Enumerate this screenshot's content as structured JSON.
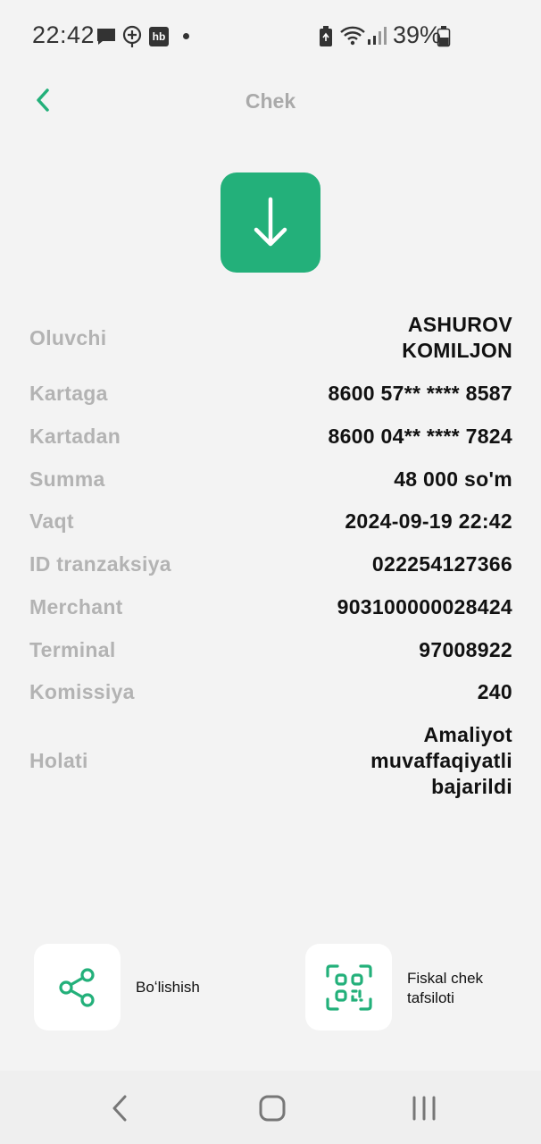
{
  "status_bar": {
    "time": "22:42",
    "battery_percent": "39%",
    "icons": [
      "message-icon",
      "add-location-icon",
      "hb-app-icon",
      "dot-icon",
      "battery-saver-icon",
      "wifi-icon",
      "signal-icon",
      "battery-icon"
    ],
    "hb_label": "hb"
  },
  "header": {
    "title": "Chek",
    "back_icon": "chevron-left-icon"
  },
  "download": {
    "icon": "arrow-down-icon",
    "color": "#23b07a"
  },
  "details": [
    {
      "label": "Oluvchi",
      "value": "ASHUROV\nKOMILJON"
    },
    {
      "label": "Kartaga",
      "value": "8600 57** **** 8587"
    },
    {
      "label": "Kartadan",
      "value": "8600 04** **** 7824"
    },
    {
      "label": "Summa",
      "value": "48 000 so'm"
    },
    {
      "label": "Vaqt",
      "value": "2024-09-19 22:42"
    },
    {
      "label": "ID tranzaksiya",
      "value": "022254127366"
    },
    {
      "label": "Merchant",
      "value": "903100000028424"
    },
    {
      "label": "Terminal",
      "value": "97008922"
    },
    {
      "label": "Komissiya",
      "value": "240"
    },
    {
      "label": "Holati",
      "value": "Amaliyot\nmuvaffaqiyatli\nbajarildi"
    }
  ],
  "actions": {
    "share": {
      "label": "Boʻlishish",
      "icon": "share-icon"
    },
    "fiscal": {
      "label": "Fiskal chek\ntafsiloti",
      "icon": "qr-scan-icon"
    }
  },
  "nav": {
    "icons": [
      "nav-back-icon",
      "nav-home-icon",
      "nav-recents-icon"
    ]
  },
  "colors": {
    "accent": "#23b07a",
    "background": "#f3f3f3",
    "label": "#b3b3b3"
  }
}
